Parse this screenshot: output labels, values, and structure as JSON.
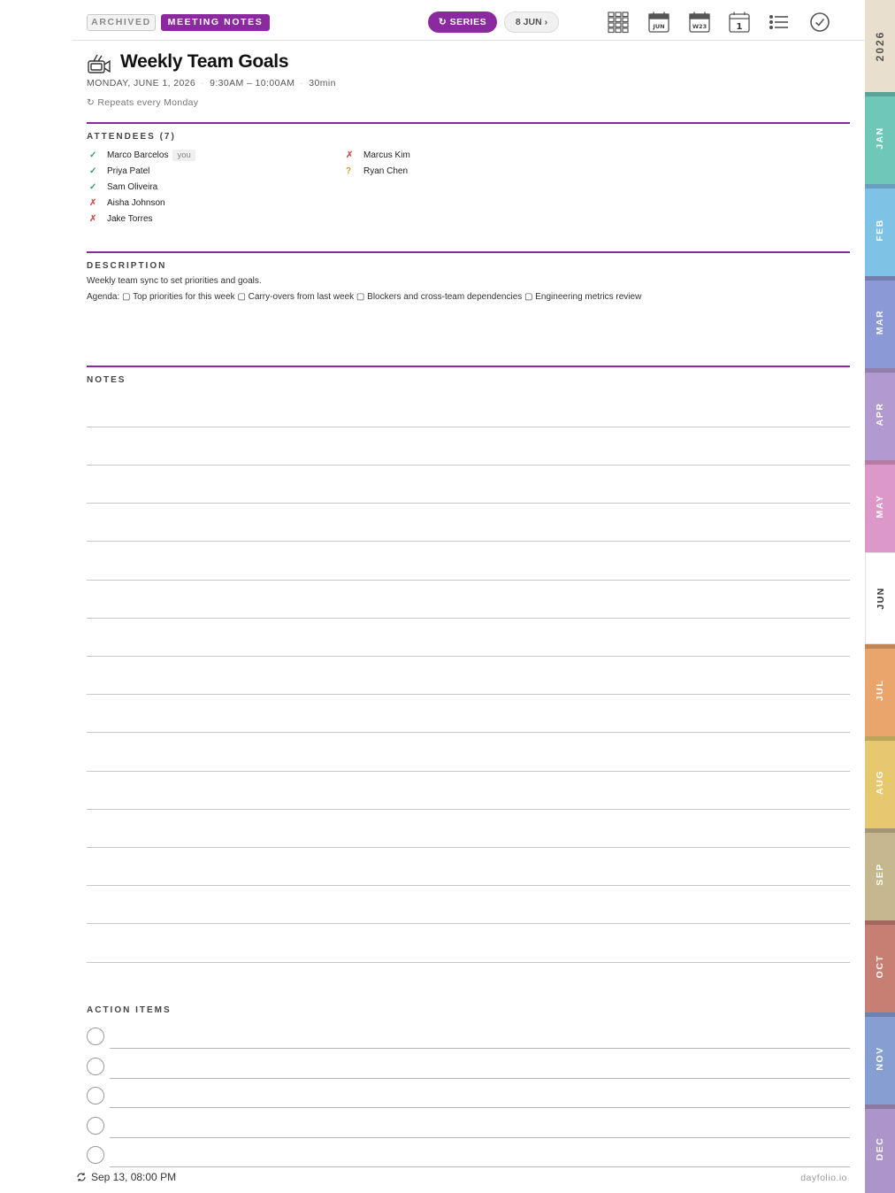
{
  "topbar": {
    "archived_label": "ARCHIVED",
    "type_label": "MEETING NOTES",
    "series_label": "↻ SERIES",
    "next_label": "8 JUN ›",
    "nav_icons": [
      "year-grid-icon",
      "month-calendar-icon",
      "week-calendar-icon",
      "day-calendar-icon",
      "list-icon",
      "checkmark-circle-icon"
    ],
    "month_icon_text": "JUN",
    "week_icon_text": "W23",
    "day_icon_text": "1"
  },
  "header": {
    "title": "Weekly Team Goals",
    "date": "MONDAY, JUNE 1, 2026",
    "time": "9:30AM – 10:00AM",
    "duration": "30min",
    "repeat": "↻ Repeats every Monday"
  },
  "attendees": {
    "label": "ATTENDEES (7)",
    "you_tag": "you",
    "col1": [
      {
        "status": "accepted",
        "mark": "✓",
        "name": "Marco Barcelos",
        "is_you": true
      },
      {
        "status": "accepted",
        "mark": "✓",
        "name": "Priya Patel"
      },
      {
        "status": "accepted",
        "mark": "✓",
        "name": "Sam Oliveira"
      },
      {
        "status": "declined",
        "mark": "✗",
        "name": "Aisha Johnson"
      },
      {
        "status": "declined",
        "mark": "✗",
        "name": "Jake Torres"
      }
    ],
    "col2": [
      {
        "status": "declined",
        "mark": "✗",
        "name": "Marcus Kim"
      },
      {
        "status": "tentative",
        "mark": "?",
        "name": "Ryan Chen"
      }
    ]
  },
  "description": {
    "label": "DESCRIPTION",
    "line1": "Weekly team sync to set priorities and goals.",
    "line2": "Agenda: ▢ Top priorities for this week ▢ Carry-overs from last week ▢ Blockers and cross-team dependencies ▢ Engineering metrics review"
  },
  "notes": {
    "label": "NOTES"
  },
  "action_items": {
    "label": "ACTION ITEMS"
  },
  "footer": {
    "sync_time": "Sep 13, 08:00 PM",
    "brand": "dayfolio.io"
  },
  "tabs": {
    "year": "2026",
    "months": [
      "JAN",
      "FEB",
      "MAR",
      "APR",
      "MAY",
      "JUN",
      "JUL",
      "AUG",
      "SEP",
      "OCT",
      "NOV",
      "DEC"
    ],
    "active": "JUN",
    "colors": {
      "year": "#e9dfcf",
      "JAN": "#6ec7b9",
      "FEB": "#7ec3e6",
      "MAR": "#8b99d6",
      "APR": "#b29ad0",
      "MAY": "#dc98c8",
      "JUN": "#ffffff",
      "JUL": "#e9a56c",
      "AUG": "#e6c86e",
      "SEP": "#c6b88e",
      "OCT": "#c67f72",
      "NOV": "#869ed2",
      "DEC": "#ad95c9"
    }
  },
  "colors": {
    "accent": "#8a2a9e",
    "accepted": "#3a9a6a",
    "declined": "#c85a5a",
    "tentative": "#d4a020"
  }
}
